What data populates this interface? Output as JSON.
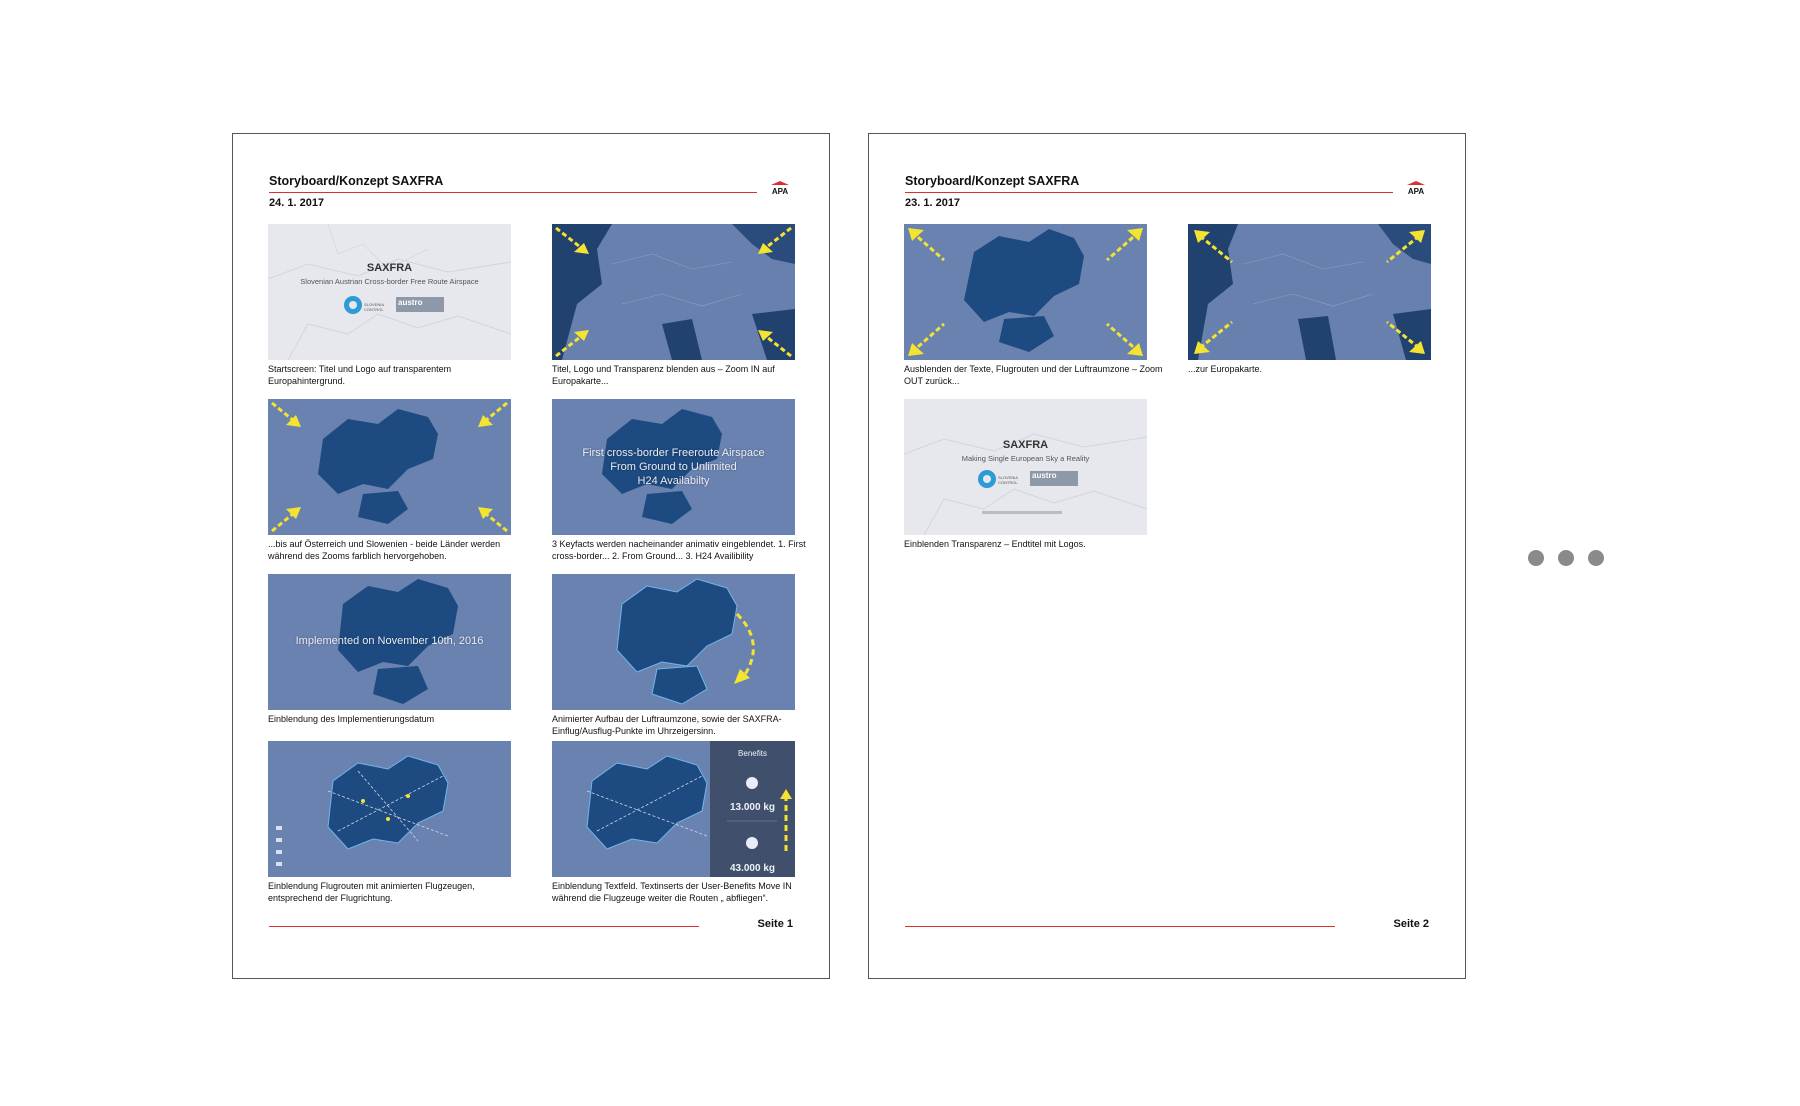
{
  "pages": [
    {
      "title": "Storyboard/Konzept  SAXFRA",
      "date": "24. 1. 2017",
      "page_label": "Seite 1",
      "logo_text": "APA",
      "frames": [
        {
          "caption": "Startscreen: Titel und Logo auf transparentem Europahintergrund.",
          "overlay": {
            "title": "SAXFRA",
            "subtitle": "Slovenian Austrian Cross-border Free Route Airspace",
            "logo_small": "SLOVENIA CONTROL",
            "logo_brand": "austro",
            "logo_brand_sub": "CONTROL"
          }
        },
        {
          "caption": "Titel, Logo und Transparenz blenden aus – Zoom IN  auf Europakarte..."
        },
        {
          "caption": "...bis auf Österreich und Slowenien - beide Länder werden während des Zooms farblich hervorgehoben."
        },
        {
          "caption": "3 Keyfacts werden nacheinander animativ eingeblendet. 1. First cross-border... 2. From Ground... 3. H24 Availibility",
          "overlay": {
            "lines": [
              "First cross-border Freeroute Airspace",
              "From Ground to Unlimited",
              "H24 Availabilty"
            ]
          }
        },
        {
          "caption": "Einblendung des Implementierungsdatum",
          "overlay": {
            "lines": [
              "Implemented on November 10th, 2016"
            ]
          }
        },
        {
          "caption": "Animierter Aufbau der Luftraumzone, sowie der SAXFRA-Einflug/Ausflug-Punkte im Uhrzeigersinn."
        },
        {
          "caption": "Einblendung Flugrouten mit animierten Flugzeugen, entsprechend der Flugrichtung."
        },
        {
          "caption": "Einblendung Textfeld. Textinserts der User-Benefits Move IN während die Flugzeuge weiter die Routen „ abfliegen“.",
          "overlay": {
            "heading": "Benefits",
            "value1": "13.000 kg",
            "value2": "43.000 kg"
          }
        }
      ]
    },
    {
      "title": "Storyboard/Konzept  SAXFRA",
      "date": "23. 1. 2017",
      "page_label": "Seite 2",
      "logo_text": "APA",
      "frames": [
        {
          "caption": "Ausblenden der Texte, Flugrouten und der Luftraumzone – Zoom OUT zurück..."
        },
        {
          "caption": "...zur Europakarte."
        },
        {
          "caption": "Einblenden Transparenz – Endtitel mit Logos.",
          "overlay": {
            "title": "SAXFRA",
            "subtitle": "Making Single European Sky a Reality",
            "logo_small": "SLOVENIA CONTROL",
            "logo_brand": "austro",
            "logo_brand_sub": "CONTROL"
          }
        }
      ]
    }
  ],
  "colors": {
    "accent_red": "#d93030",
    "map_light": "#6b83b0",
    "map_dark": "#1c3f70",
    "map_zone": "#1e4f86",
    "arrow_yellow": "#f5e332",
    "pagination_dot": "#8a8a8a"
  },
  "pagination": {
    "dots": 3
  }
}
